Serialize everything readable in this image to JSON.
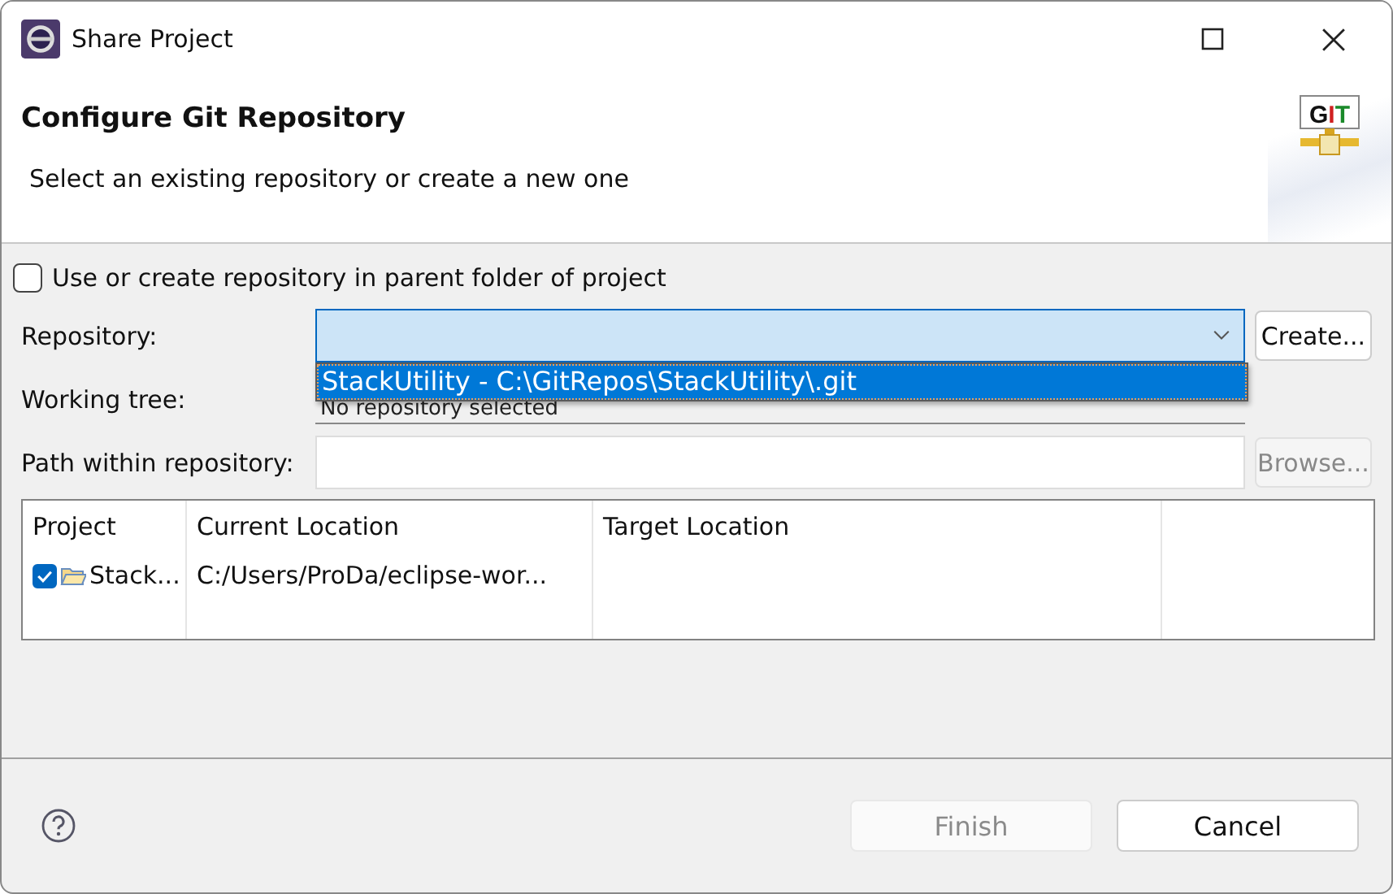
{
  "window": {
    "title": "Share Project"
  },
  "header": {
    "title": "Configure Git Repository",
    "description": "Select an existing repository or create a new one",
    "logo_text": "GIT"
  },
  "parent_folder_checkbox": {
    "label": "Use or create repository in parent folder of project",
    "checked": false
  },
  "repository": {
    "label": "Repository:",
    "dropdown_open": true,
    "options": [
      {
        "label": "StackUtility - C:\\GitRepos\\StackUtility\\.git",
        "selected": true
      }
    ],
    "button": {
      "label": "Create...",
      "disabled": false
    }
  },
  "working_tree": {
    "label": "Working tree:",
    "value": "No repository selected"
  },
  "path_within_repository": {
    "label": "Path within repository:",
    "button": {
      "label": "Browse...",
      "disabled": true
    }
  },
  "table": {
    "columns": [
      "Project",
      "Current Location",
      "Target Location"
    ],
    "rows": [
      {
        "checked": true,
        "cells": [
          "Stack...",
          "C:/Users/ProDa/eclipse-wor...",
          ""
        ]
      }
    ]
  },
  "buttons": [
    {
      "label": "Finish",
      "disabled": true
    },
    {
      "label": "Cancel",
      "disabled": false
    }
  ]
}
